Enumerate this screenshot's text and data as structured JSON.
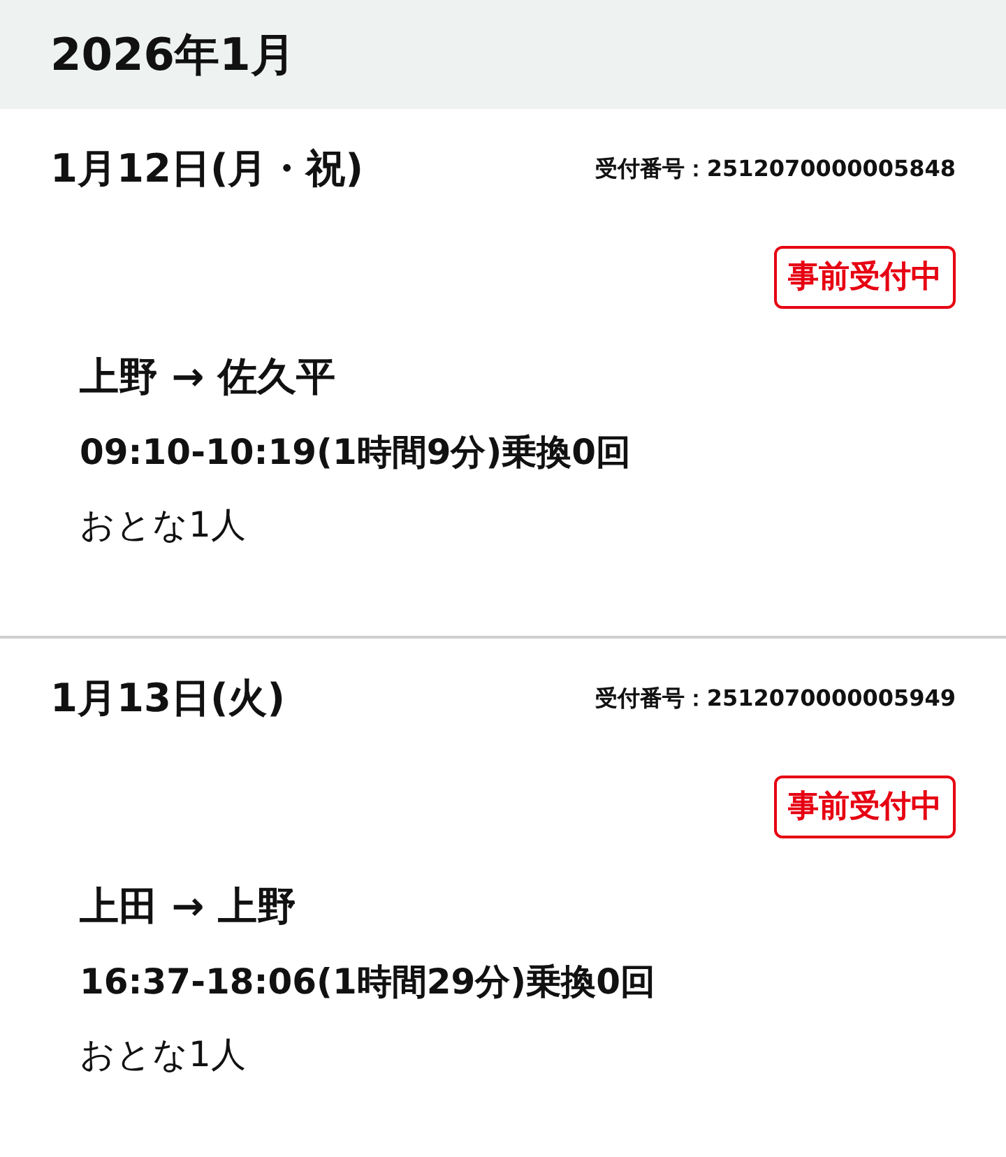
{
  "header": {
    "title": "2026年1月"
  },
  "reservations": [
    {
      "date": "1月12日(月・祝)",
      "receipt": "受付番号：2512070000005848",
      "status": "事前受付中",
      "route": "上野 → 佐久平",
      "time": "09:10-10:19(1時間9分)乗換0回",
      "passengers": "おとな1人"
    },
    {
      "date": "1月13日(火)",
      "receipt": "受付番号：2512070000005949",
      "status": "事前受付中",
      "route": "上田 → 上野",
      "time": "16:37-18:06(1時間29分)乗換0回",
      "passengers": "おとな1人"
    }
  ]
}
